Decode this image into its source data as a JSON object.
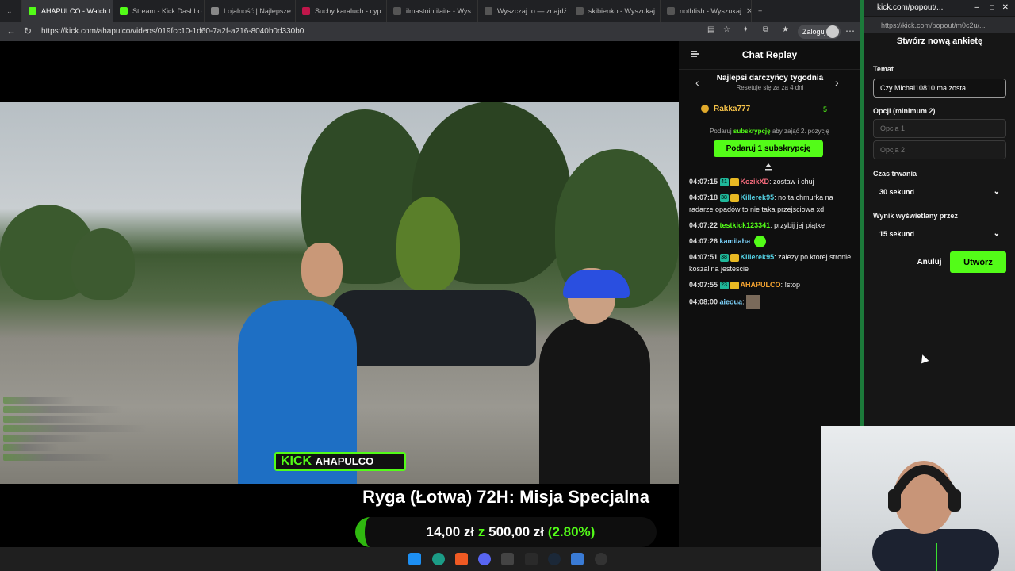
{
  "browser": {
    "tabs": [
      {
        "label": "AHAPULCO - Watch t",
        "color": "#53fc18",
        "active": true
      },
      {
        "label": "Stream - Kick Dashbo",
        "color": "#53fc18"
      },
      {
        "label": "Lojalność | Najlepsze",
        "color": "#888888"
      },
      {
        "label": "Suchy karaluch - cyp",
        "color": "#c0164a"
      },
      {
        "label": "ilmastointilaite - Wys",
        "color": "#555555"
      },
      {
        "label": "Wyszczaj.to — znajdź",
        "color": "#555555"
      },
      {
        "label": "skibienko - Wyszukaj",
        "color": "#555555"
      },
      {
        "label": "nothfish - Wyszukaj",
        "color": "#555555"
      }
    ],
    "url": "https://kick.com/ahapulco/videos/019fcc10-1d60-7a2f-a216-8040b0d330b0",
    "login_label": "Zaloguj"
  },
  "video": {
    "watermark_brand": "KICK",
    "watermark_channel": "AHAPULCO",
    "overlay_title": "Ryga (Łotwa) 72H: Misja Specjalna",
    "goal_current": "14,00 zł",
    "goal_sep": "z",
    "goal_target": "500,00 zł",
    "goal_pct": "(2.80%)"
  },
  "chat": {
    "title": "Chat Replay",
    "donors_title": "Najlepsi darczyńcy tygodnia",
    "donors_sub": "Resetuje się za za 4 dni",
    "top_donor": "Rakka777",
    "top_donor_count": "5",
    "gift_hint_pre": "Podaruj",
    "gift_hint_link": "subskrypcję",
    "gift_hint_post": "aby zająć 2. pozycję",
    "gift_button": "Podaruj 1 subskrypcję",
    "messages": [
      {
        "time": "04:07:15",
        "user": "KozikXD",
        "color": "#f56b7c",
        "text": ": zostaw i chuj",
        "badge": "41"
      },
      {
        "time": "04:07:18",
        "user": "Killerek95",
        "color": "#54d3e6",
        "text": ": no ta chmurka na radarze opadów to nie taka przejsciowa xd",
        "badge": "38"
      },
      {
        "time": "04:07:22",
        "user": "testkick123341",
        "color": "#53fc18",
        "text": ": przybij jej piątke",
        "badge": ""
      },
      {
        "time": "04:07:26",
        "user": "kamilaha",
        "color": "#7fd6ff",
        "text": ":",
        "badge": ""
      },
      {
        "time": "04:07:51",
        "user": "Killerek95",
        "color": "#54d3e6",
        "text": ": zalezy po ktorej stronie koszalina jestescie",
        "badge": "38"
      },
      {
        "time": "04:07:55",
        "user": "AHAPULCO",
        "color": "#f7a531",
        "text": ": !stop",
        "badge": "23"
      },
      {
        "time": "04:08:00",
        "user": "aieoua",
        "color": "#7fd6ff",
        "text": ":",
        "badge": ""
      }
    ]
  },
  "popout": {
    "window_title": "kick.com/popout/...",
    "url": "https://kick.com/popout/m0c2u/...",
    "heading": "Stwórz nową ankietę",
    "topic_label": "Temat",
    "topic_value": "Czy Michal10810 ma zosta",
    "options_label": "Opcji (minimum 2)",
    "option1_placeholder": "Opcja 1",
    "option2_placeholder": "Opcja 2",
    "duration_label": "Czas trwania",
    "duration_value": "30 sekund",
    "result_label": "Wynik wyświetlany przez",
    "result_value": "15 sekund",
    "cancel_label": "Anuluj",
    "create_label": "Utwórz"
  },
  "colors": {
    "accent": "#53fc18",
    "chat_bg": "#0f0f0f",
    "popout_bg": "#161616"
  }
}
